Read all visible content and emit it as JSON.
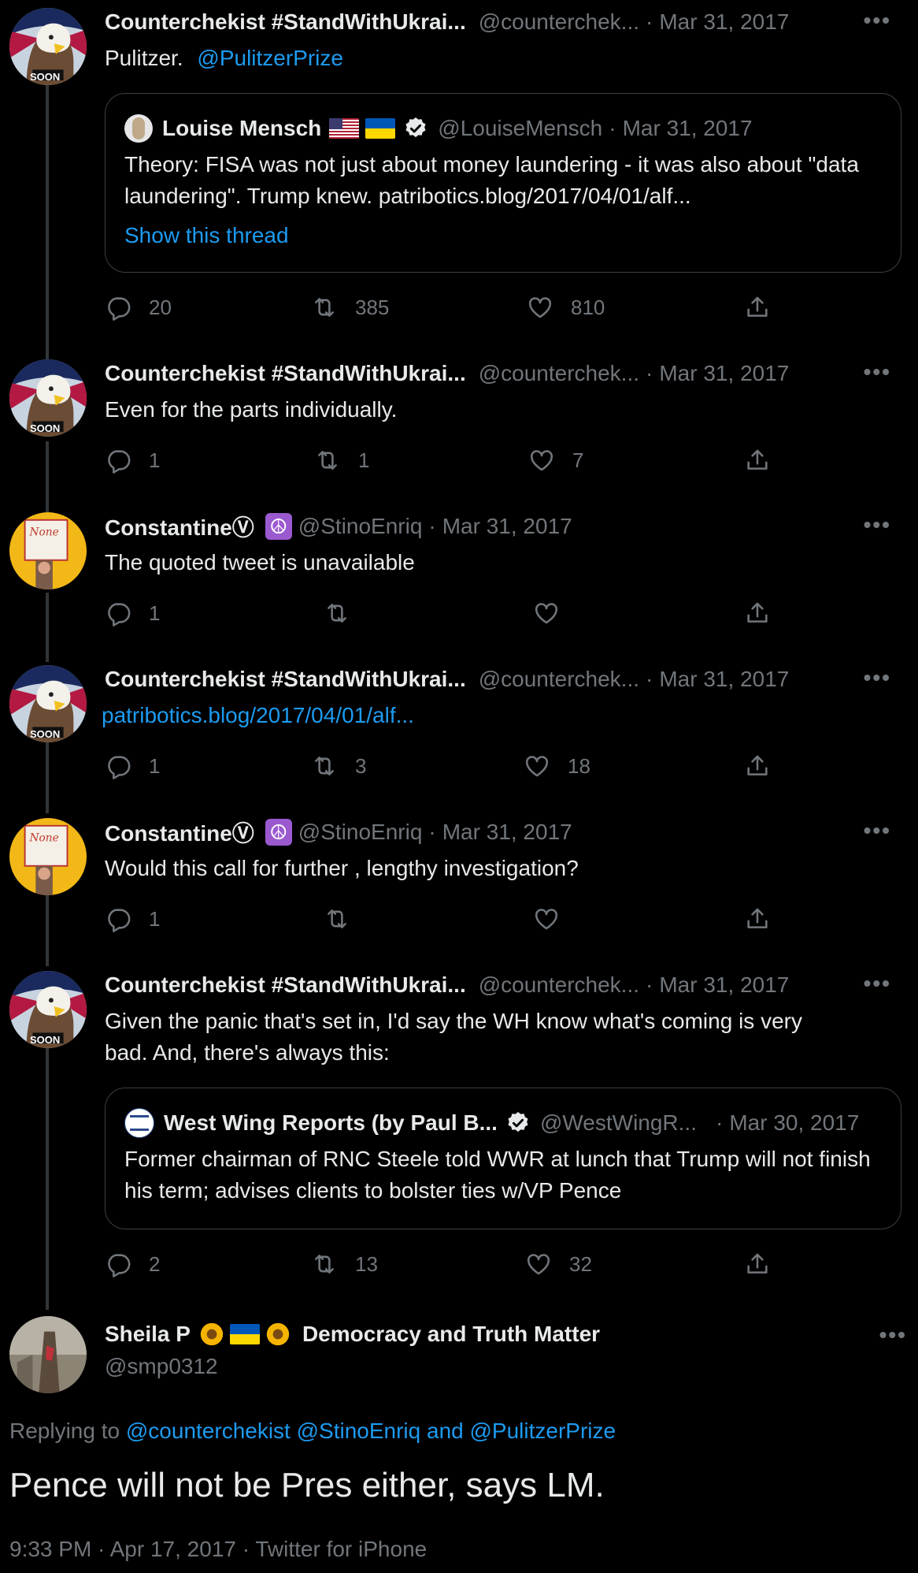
{
  "accounts": {
    "counter": {
      "name": "Counterchekist #StandWithUkrai...",
      "handle": "@counterchek..."
    },
    "constantine": {
      "name": "ConstantineⓋ",
      "handle": "@StinoEnriq"
    },
    "louise": {
      "name": "Louise Mensch",
      "handle": "@LouiseMensch"
    },
    "westwing": {
      "name": "West Wing Reports (by Paul B...",
      "handle": "@WestWingR..."
    }
  },
  "avatar_badge": "SOON",
  "sep": "·",
  "tweets": [
    {
      "date": "Mar 31, 2017",
      "text": "Pulitzer.",
      "mention": "@PulitzerPrize",
      "quote": {
        "date": "Mar 31, 2017",
        "text": "Theory: FISA was not just about money laundering - it was also about \"data laundering\". Trump knew. patribotics.blog/2017/04/01/alf...",
        "show_thread": "Show this thread"
      },
      "replies": "20",
      "retweets": "385",
      "likes": "810"
    },
    {
      "date": "Mar 31, 2017",
      "text": "Even for the parts individually.",
      "replies": "1",
      "retweets": "1",
      "likes": "7"
    },
    {
      "date": "Mar 31, 2017",
      "text": "The quoted tweet is unavailable",
      "replies": "1",
      "retweets": "",
      "likes": ""
    },
    {
      "date": "Mar 31, 2017",
      "link": "patribotics.blog/2017/04/01/alf...",
      "replies": "1",
      "retweets": "3",
      "likes": "18"
    },
    {
      "date": "Mar 31, 2017",
      "text": "Would this call for further , lengthy investigation?",
      "replies": "1",
      "retweets": "",
      "likes": ""
    },
    {
      "date": "Mar 31, 2017",
      "text_line1": "Given the panic that's set in, I'd say the WH know what's coming is very",
      "text_line2": "bad. And, there's always this:",
      "quote": {
        "date": "Mar 30, 2017",
        "text": "Former chairman of RNC Steele told WWR at lunch that Trump will not finish his term; advises clients to bolster ties w/VP Pence"
      },
      "replies": "2",
      "retweets": "13",
      "likes": "32"
    }
  ],
  "main_tweet": {
    "name_start": "Sheila P",
    "name_end": "Democracy and Truth Matter",
    "handle": "@smp0312",
    "replying_prefix": "Replying to",
    "replying_mentions": "@counterchekist @StinoEnriq and @PulitzerPrize",
    "text": "Pence will not be Pres either, says LM.",
    "meta": "9:33 PM · Apr 17, 2017 · Twitter for iPhone"
  },
  "colors": {
    "background": "#000000",
    "text": "#e7e9ea",
    "muted": "#71767b",
    "link": "#1d9bf0",
    "border": "#3a3f44"
  },
  "icons": [
    "reply-icon",
    "retweet-icon",
    "like-icon",
    "share-icon",
    "more-icon",
    "verified-icon"
  ]
}
